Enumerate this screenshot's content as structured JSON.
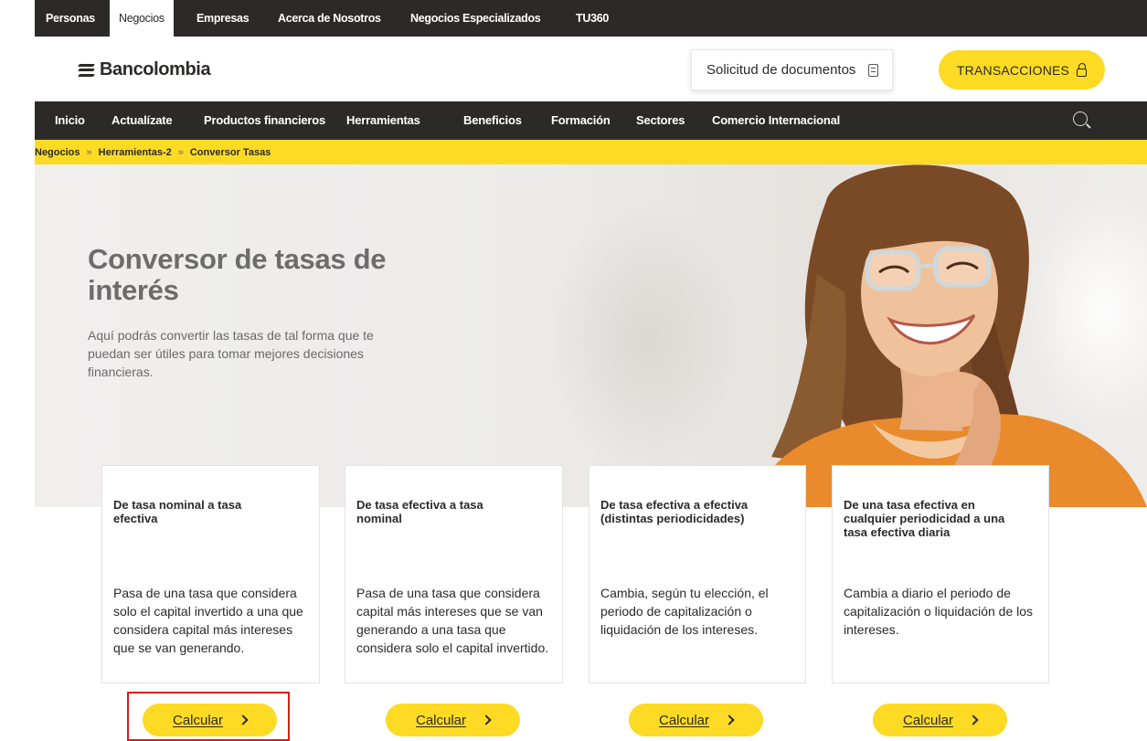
{
  "segments": [
    "Personas",
    "Negocios",
    "Empresas",
    "Acerca de Nosotros",
    "Negocios Especializados",
    "TU360"
  ],
  "header": {
    "logo": "Bancolombia",
    "documents": "Solicitud de documentos",
    "transactions": "TRANSACCIONES"
  },
  "nav": [
    "Inicio",
    "Actualízate",
    "Productos financieros",
    "Herramientas",
    "Beneficios",
    "Formación",
    "Sectores",
    "Comercio Internacional"
  ],
  "breadcrumb": [
    "Negocios",
    "Herramientas-2",
    "Conversor Tasas"
  ],
  "breadcrumb_sep": "»",
  "hero": {
    "title": "Conversor de tasas de interés",
    "description": "Aquí podrás convertir las tasas de tal forma que te puedan ser útiles para tomar mejores decisiones financieras."
  },
  "cards": [
    {
      "title": "De tasa nominal a tasa efectiva",
      "description": "Pasa de una tasa que considera solo el capital invertido a una que considera capital más intereses que se van generando.",
      "button": "Calcular"
    },
    {
      "title": "De tasa efectiva a tasa nominal",
      "description": "Pasa de una tasa que considera capital más intereses que se van generando a una tasa que considera solo el capital invertido.",
      "button": "Calcular"
    },
    {
      "title": "De tasa efectiva a efectiva (distintas periodicidades)",
      "description": "Cambia, según tu elección, el periodo de capitalización o liquidación de los intereses.",
      "button": "Calcular"
    },
    {
      "title": "De una tasa efectiva en cualquier periodicidad a una tasa efectiva diaria",
      "description": "Cambia a diario el periodo de capitalización o liquidación de los intereses.",
      "button": "Calcular"
    }
  ],
  "colors": {
    "brand_yellow": "#fdda24",
    "dark": "#2c2a29",
    "highlight": "#e0191b"
  },
  "icons": [
    "document-icon",
    "lock-icon",
    "search-icon",
    "chevron-right-icon"
  ]
}
